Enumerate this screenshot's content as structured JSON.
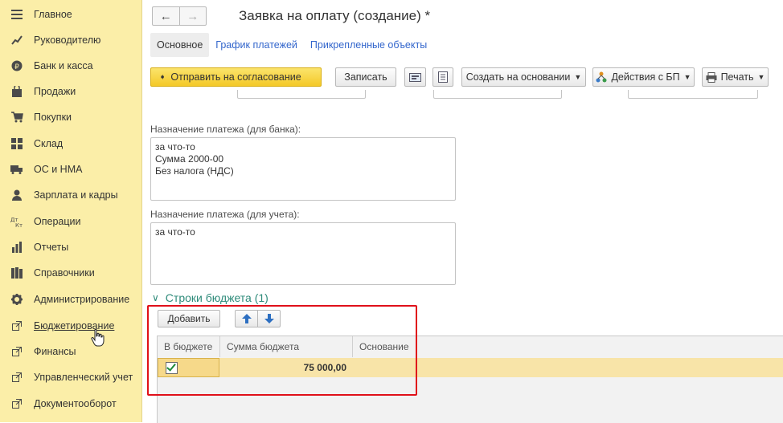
{
  "sidebar": {
    "items": [
      {
        "icon": "menu-icon",
        "label": "Главное"
      },
      {
        "icon": "chart-up-icon",
        "label": "Руководителю"
      },
      {
        "icon": "ruble-coin-icon",
        "label": "Банк и касса"
      },
      {
        "icon": "shopping-bag-icon",
        "label": "Продажи"
      },
      {
        "icon": "cart-icon",
        "label": "Покупки"
      },
      {
        "icon": "warehouse-grid-icon",
        "label": "Склад"
      },
      {
        "icon": "truck-icon",
        "label": "ОС и НМА"
      },
      {
        "icon": "person-icon",
        "label": "Зарплата и кадры"
      },
      {
        "icon": "dt-kt-icon",
        "label": "Операции"
      },
      {
        "icon": "bar-chart-icon",
        "label": "Отчеты"
      },
      {
        "icon": "books-icon",
        "label": "Справочники"
      },
      {
        "icon": "gear-icon",
        "label": "Администрирование"
      },
      {
        "icon": "external-link-icon",
        "label": "Бюджетирование"
      },
      {
        "icon": "external-link-icon",
        "label": "Финансы"
      },
      {
        "icon": "external-link-icon",
        "label": "Управленческий учет"
      },
      {
        "icon": "external-link-icon",
        "label": "Документооборот"
      }
    ]
  },
  "header": {
    "title": "Заявка на оплату (создание) *",
    "back_icon": "arrow-left-icon",
    "forward_icon": "arrow-right-icon"
  },
  "tabs": [
    "Основное",
    "График платежей",
    "Прикрепленные объекты"
  ],
  "toolbar": {
    "send_label": "Отправить на согласование",
    "save_label": "Записать",
    "create_based_label": "Создать на основании",
    "actions_label": "Действия с БП",
    "print_label": "Печать"
  },
  "bank_purpose": {
    "label": "Назначение платежа (для банка):",
    "lines": [
      "за что-то",
      "Сумма 2000-00",
      "Без налога (НДС)"
    ]
  },
  "accounting_purpose": {
    "label": "Назначение платежа (для учета):",
    "value": "за что-то"
  },
  "budget_section": {
    "title": "Строки бюджета (1)",
    "add_label": "Добавить",
    "columns": [
      "В бюджете",
      "Сумма бюджета",
      "Основание"
    ],
    "rows": [
      {
        "in_budget": true,
        "amount": "75 000,00",
        "basis": ""
      }
    ]
  },
  "colors": {
    "sidebar_bg": "#fbeea8",
    "primary_button": "#f4c928",
    "selected_row": "#f8e4a8",
    "section_title": "#2e8b7a",
    "highlight_box": "#e0101a"
  }
}
